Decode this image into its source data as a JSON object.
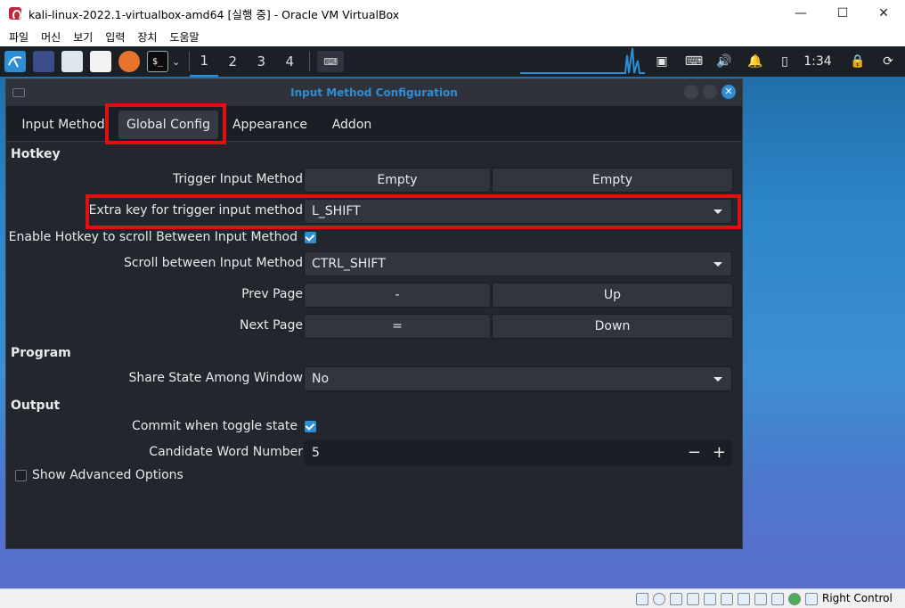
{
  "host": {
    "title": "kali-linux-2022.1-virtualbox-amd64 [실행 중] - Oracle VM VirtualBox",
    "menu": [
      "파일",
      "머신",
      "보기",
      "입력",
      "장치",
      "도움말"
    ],
    "status_key": "Right Control"
  },
  "panel": {
    "workspaces": [
      "1",
      "2",
      "3",
      "4"
    ],
    "clock": "1:34"
  },
  "dialog": {
    "title": "Input Method Configuration",
    "tabs": [
      "Input Method",
      "Global Config",
      "Appearance",
      "Addon"
    ],
    "active_tab": "Global Config",
    "sections": {
      "hotkey": "Hotkey",
      "program": "Program",
      "output": "Output"
    },
    "rows": {
      "trigger": {
        "label": "Trigger Input Method",
        "value1": "Empty",
        "value2": "Empty"
      },
      "extra_key": {
        "label": "Extra key for trigger input method",
        "value": "L_SHIFT"
      },
      "enable_scroll": {
        "label": "Enable Hotkey to scroll Between Input Method",
        "checked": true
      },
      "scroll_between": {
        "label": "Scroll between Input Method",
        "value": "CTRL_SHIFT"
      },
      "prev_page": {
        "label": "Prev Page",
        "value1": "-",
        "value2": "Up"
      },
      "next_page": {
        "label": "Next Page",
        "value1": "=",
        "value2": "Down"
      },
      "share_state": {
        "label": "Share State Among Window",
        "value": "No"
      },
      "commit_toggle": {
        "label": "Commit when toggle state",
        "checked": true
      },
      "candidate_number": {
        "label": "Candidate Word Number",
        "value": "5",
        "minus": "−",
        "plus": "+"
      },
      "show_advanced": {
        "label": "Show Advanced Options",
        "checked": false
      }
    }
  },
  "colors": {
    "accent": "#2d8ed6",
    "highlight": "#e01010",
    "dialog_bg": "#23262d"
  }
}
